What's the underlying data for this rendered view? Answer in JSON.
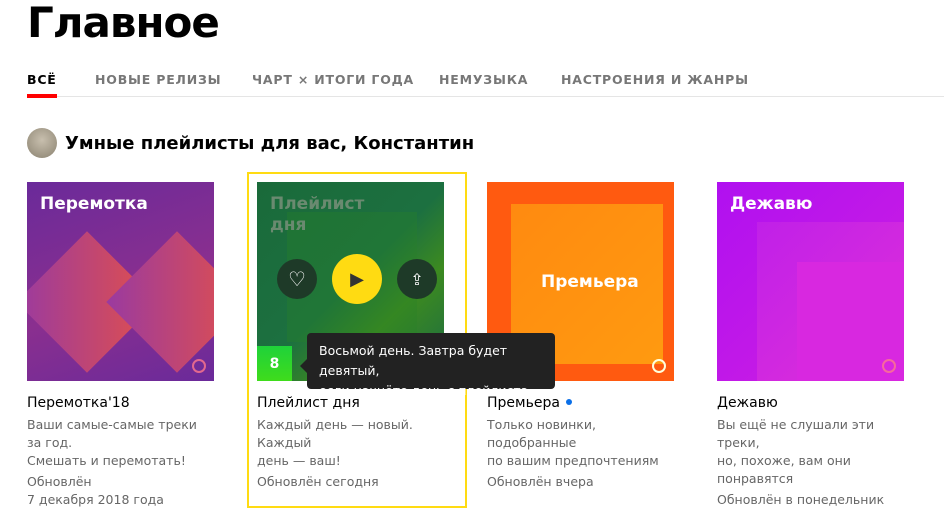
{
  "page_title": "Главное",
  "tabs": [
    {
      "label": "ВСЁ",
      "active": true
    },
    {
      "label": "НОВЫЕ РЕЛИЗЫ"
    },
    {
      "label": "ЧАРТ × ИТОГИ ГОДА"
    },
    {
      "label": "НЕМУЗЫКА"
    },
    {
      "label": "НАСТРОЕНИЯ И ЖАНРЫ"
    }
  ],
  "section_title": "Умные плейлисты для вас, Константин",
  "playlists": [
    {
      "cover_title": "Перемотка",
      "name": "Перемотка'18",
      "desc1": "Ваши самые-самые треки за год.",
      "desc2": "Смешать и перемотать!",
      "upd1": "Обновлён",
      "upd2": " 7 декабря 2018 года"
    },
    {
      "cover_title": "Плейлист дня",
      "name": "Плейлист дня",
      "desc1": "Каждый день — новый. Каждый",
      "desc2": "день — ваш!",
      "upd1": "Обновлён сегодня",
      "day_count": "8"
    },
    {
      "cover_title": "Премьера",
      "name": "Премьера",
      "desc1": "Только новинки, подобранные",
      "desc2": "по вашим предпочтениям",
      "upd1": "Обновлён вчера"
    },
    {
      "cover_title": "Дежавю",
      "name": "Дежавю",
      "desc1": "Вы ещё не слушали эти треки,",
      "desc2": "но, похоже, вам они понравятся",
      "upd1": "Обновлён в понедельник"
    }
  ],
  "tooltip": {
    "line1": "Восьмой день. Завтра будет девятый,",
    "line2": "если начнёте день с плейлиста"
  },
  "colors": {
    "accent": "#ffdb12",
    "tab_active": "#ff0000",
    "new_dot": "#0a6fe8"
  }
}
